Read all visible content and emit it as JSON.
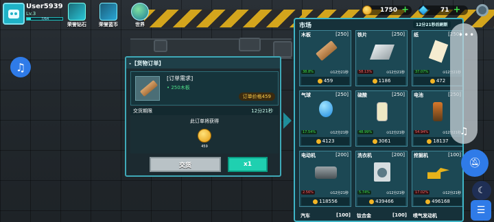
{
  "player": {
    "username": "User5939",
    "level": "Lv.3",
    "xp_text": "7/64",
    "xp_progress": 0.11
  },
  "top_icons": [
    {
      "label": "荣誉钻石",
      "icon": "honor-diamond-icon",
      "color": "#29c4d6"
    },
    {
      "label": "荣誉蓝币",
      "icon": "honor-bluecoin-icon",
      "color": "#2aa6d6"
    },
    {
      "label": "世界",
      "icon": "globe-icon",
      "color": "#3fb07a"
    }
  ],
  "currency": {
    "coins": "1750",
    "gems": "71"
  },
  "order": {
    "title": "-【货物订单】",
    "req_title": "[订单需求]",
    "req_item": "• 250木板",
    "price": "订单价格459",
    "deadline_label": "交货期限",
    "deadline_time": "12分21秒",
    "reward_title": "此订单将获得",
    "reward_value": "459",
    "deliver_label": "交货",
    "mult_label": "x1"
  },
  "market": {
    "title": "市场",
    "timer": "12分21秒后刷新",
    "items": [
      {
        "name": "木板",
        "qty": "[250]",
        "change": "38.8%",
        "dir": "up",
        "time": "12分21秒",
        "price": "459",
        "icon": "wood-plank-icon"
      },
      {
        "name": "铁片",
        "qty": "[250]",
        "change": "58.13%",
        "dir": "down",
        "time": "12分21秒",
        "price": "1186",
        "icon": "iron-sheet-icon"
      },
      {
        "name": "纸",
        "qty": "[250]",
        "change": "37.07%",
        "dir": "up",
        "time": "12分21秒",
        "price": "472",
        "icon": "paper-icon"
      },
      {
        "name": "气球",
        "qty": "[250]",
        "change": "17.54%",
        "dir": "up",
        "time": "12分21秒",
        "price": "4123",
        "icon": "balloon-icon"
      },
      {
        "name": "硫酸",
        "qty": "[250]",
        "change": "48.99%",
        "dir": "up",
        "time": "12分21秒",
        "price": "3061",
        "icon": "acid-bottle-icon"
      },
      {
        "name": "电池",
        "qty": "[250]",
        "change": "54.94%",
        "dir": "down",
        "time": "12分21秒",
        "price": "18137",
        "icon": "battery-icon"
      },
      {
        "name": "电动机",
        "qty": "[200]",
        "change": "2.56%",
        "dir": "down",
        "time": "12分21秒",
        "price": "118556",
        "icon": "motor-icon"
      },
      {
        "name": "洗衣机",
        "qty": "[200]",
        "change": "5.74%",
        "dir": "up",
        "time": "12分21秒",
        "price": "439466",
        "icon": "washer-icon"
      },
      {
        "name": "挖掘机",
        "qty": "[100]",
        "change": "17.02%",
        "dir": "down",
        "time": "12分21秒",
        "price": "496168",
        "icon": "excavator-icon"
      }
    ],
    "bottom_row": [
      "汽车",
      "[100]",
      "钛合金",
      "[100]",
      "喷气发动机"
    ]
  }
}
